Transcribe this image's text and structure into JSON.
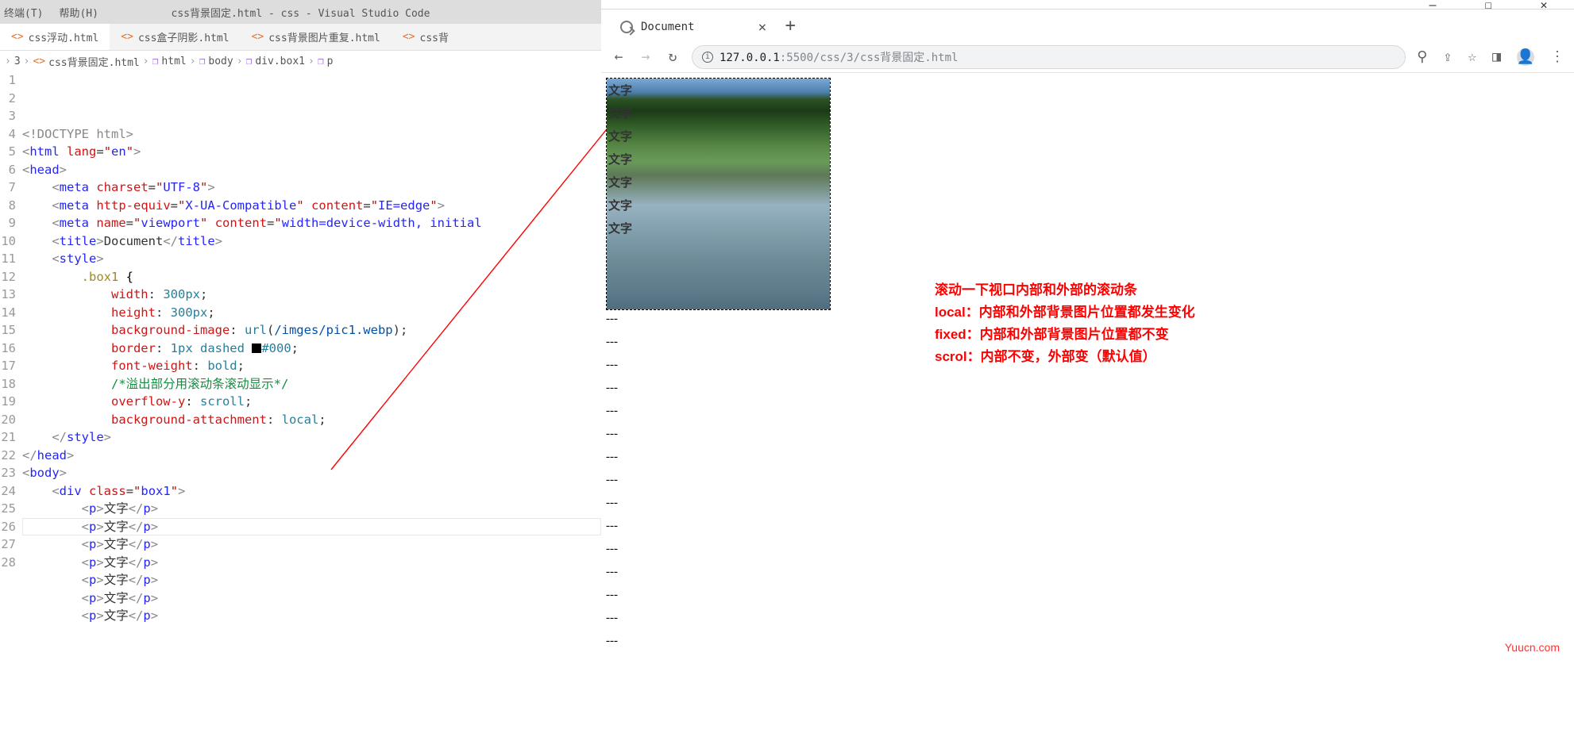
{
  "vscode": {
    "menus": [
      "终端(T)",
      "帮助(H)"
    ],
    "title": "css背景固定.html - css - Visual Studio Code",
    "tabs": [
      {
        "label": "css浮动.html",
        "active": false
      },
      {
        "label": "css盒子阴影.html",
        "active": false
      },
      {
        "label": "css背景图片重复.html",
        "active": false
      },
      {
        "label": "css背",
        "active": true,
        "truncated": true
      }
    ],
    "breadcrumb": [
      "3",
      "css背景固定.html",
      "html",
      "body",
      "div.box1",
      "p"
    ],
    "lines": [
      "1",
      "2",
      "3",
      "4",
      "5",
      "6",
      "7",
      "8",
      "9",
      "10",
      "11",
      "12",
      "13",
      "14",
      "15",
      "16",
      "17",
      "18",
      "19",
      "20",
      "21",
      "22",
      "23",
      "24",
      "25",
      "26",
      "27",
      "28"
    ],
    "code": {
      "l1": "<!DOCTYPE html>",
      "l2": {
        "tag": "html",
        "attr": "lang",
        "val": "en"
      },
      "l3": "<head>",
      "l4": {
        "tag": "meta",
        "attr": "charset",
        "val": "UTF-8"
      },
      "l5": {
        "tag": "meta",
        "attr1": "http-equiv",
        "val1": "X-UA-Compatible",
        "attr2": "content",
        "val2": "IE=edge"
      },
      "l6": {
        "tag": "meta",
        "attr1": "name",
        "val1": "viewport",
        "attr2": "content",
        "val2": "width=device-width, initial"
      },
      "l7": {
        "open": "<title>",
        "text": "Document",
        "close": "</title>"
      },
      "l8": "<style>",
      "l9": ".box1 {",
      "l10": {
        "prop": "width",
        "val": "300px"
      },
      "l11": {
        "prop": "height",
        "val": "300px"
      },
      "l12": {
        "prop": "background-image",
        "fn": "url",
        "arg": "/imges/pic1.webp"
      },
      "l13": {
        "prop": "border",
        "vals": "1px dashed",
        "color": "#000"
      },
      "l14": {
        "prop": "font-weight",
        "val": "bold"
      },
      "l15": "/*溢出部分用滚动条滚动显示*/",
      "l16": {
        "prop": "overflow-y",
        "val": "scroll"
      },
      "l17": {
        "prop": "background-attachment",
        "val": "local"
      },
      "l18": "</style>",
      "l19": "</head>",
      "l20": "<body>",
      "l21": {
        "tag": "div",
        "attr": "class",
        "val": "box1"
      },
      "ptext": "文字",
      "repeated": 7
    },
    "highlighted_line": 26
  },
  "chrome": {
    "win_buttons": [
      "—",
      "☐",
      "✕"
    ],
    "tab": {
      "title": "Document"
    },
    "nav": {
      "back": "←",
      "forward": "→",
      "reload": "↻"
    },
    "url": {
      "host": "127.0.0.1",
      "port": ":5500",
      "path": "/css/3/css背景固定.html"
    },
    "right_icons": [
      "search-icon",
      "share-icon",
      "star-icon",
      "panel-icon",
      "avatar",
      "menu-icon"
    ],
    "page": {
      "box_text": "文字",
      "box_lines": 7,
      "dashes": "---",
      "dash_count": 15
    },
    "notes": [
      "滚动一下视口内部和外部的滚动条",
      "local：内部和外部背景图片位置都发生变化",
      "fixed：内部和外部背景图片位置都不变",
      "scrol：内部不变，外部变（默认值）"
    ]
  },
  "watermark": "Yuucn.com"
}
